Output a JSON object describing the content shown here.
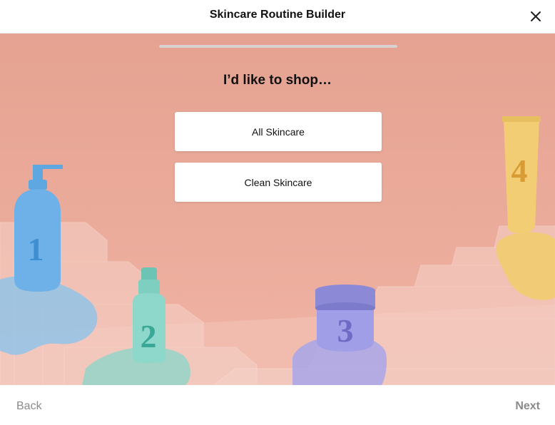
{
  "header": {
    "title": "Skincare Routine Builder",
    "close_icon": "close-icon"
  },
  "progress": {
    "fraction": 0.0
  },
  "question": {
    "title": "I’d like to shop…",
    "options": [
      {
        "label": "All Skincare"
      },
      {
        "label": "Clean Skincare"
      }
    ]
  },
  "hero_image": {
    "steps": [
      "1",
      "2",
      "3",
      "4"
    ]
  },
  "footer": {
    "back_label": "Back",
    "next_label": "Next"
  },
  "colors": {
    "background": "#e4a08f",
    "step1": "#7db7e6",
    "step2": "#8cd1c4",
    "step3": "#a6a5e3",
    "step4": "#f1c96a",
    "text_muted": "#8a8a8a"
  }
}
